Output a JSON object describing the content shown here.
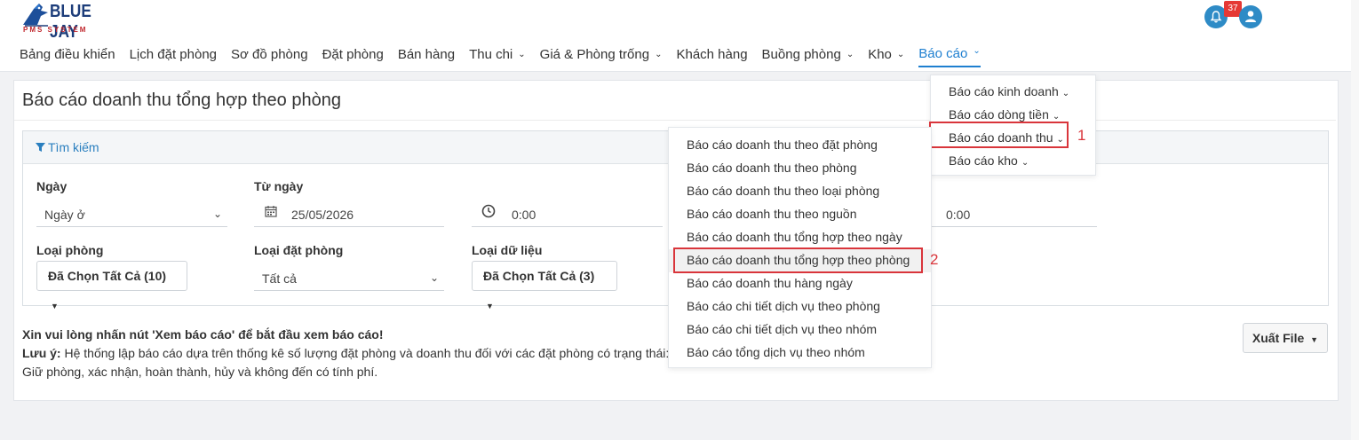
{
  "logo": {
    "title": "BLUE JAY",
    "subtitle": "PMS SYSTEM"
  },
  "header": {
    "notification_count": "37"
  },
  "nav": {
    "items": [
      {
        "label": "Bảng điều khiển"
      },
      {
        "label": "Lịch đặt phòng"
      },
      {
        "label": "Sơ đồ phòng"
      },
      {
        "label": "Đặt phòng"
      },
      {
        "label": "Bán hàng"
      },
      {
        "label": "Thu chi"
      },
      {
        "label": "Giá & Phòng trống"
      },
      {
        "label": "Khách hàng"
      },
      {
        "label": "Buồng phòng"
      },
      {
        "label": "Kho"
      },
      {
        "label": "Báo cáo"
      }
    ],
    "chevron": "˅"
  },
  "page": {
    "title": "Báo cáo doanh thu tổng hợp theo phòng"
  },
  "search": {
    "header_label": "Tìm kiếm",
    "date_type_label": "Ngày",
    "date_type_value": "Ngày ở",
    "from_label": "Từ ngày",
    "from_value": "25/05/2026",
    "from_time": "0:00",
    "to_time": "0:00",
    "room_type_label": "Loại phòng",
    "room_type_value": "Đã Chọn Tất Cả (10)",
    "booking_type_label": "Loại đặt phòng",
    "booking_type_value": "Tất cả",
    "data_type_label": "Loại dữ liệu",
    "data_type_value": "Đã Chọn Tất Cả (3)"
  },
  "note": {
    "instruction": "Xin vui lòng nhấn nút 'Xem báo cáo' để bắt đầu xem báo cáo!",
    "note_label": "Lưu ý:",
    "note_text": " Hệ thống lập báo cáo dựa trên thống kê số lượng đặt phòng và doanh thu đối với các đặt phòng có trạng thái:",
    "note_text2": "Giữ phòng, xác nhận, hoàn thành, hủy và không đến có tính phí."
  },
  "export": {
    "label": "Xuất File"
  },
  "report_menu": {
    "items": [
      {
        "label": "Báo cáo kinh doanh"
      },
      {
        "label": "Báo cáo dòng tiền"
      },
      {
        "label": "Báo cáo doanh thu"
      },
      {
        "label": "Báo cáo kho"
      }
    ]
  },
  "revenue_menu": {
    "items": [
      {
        "label": "Báo cáo doanh thu theo đặt phòng"
      },
      {
        "label": "Báo cáo doanh thu theo phòng"
      },
      {
        "label": "Báo cáo doanh thu theo loại phòng"
      },
      {
        "label": "Báo cáo doanh thu theo nguồn"
      },
      {
        "label": "Báo cáo doanh thu tổng hợp theo ngày"
      },
      {
        "label": "Báo cáo doanh thu tổng hợp theo phòng"
      },
      {
        "label": "Báo cáo doanh thu hàng ngày"
      },
      {
        "label": "Báo cáo chi tiết dịch vụ theo phòng"
      },
      {
        "label": "Báo cáo chi tiết dịch vụ theo nhóm"
      },
      {
        "label": "Báo cáo tổng dịch vụ theo nhóm"
      }
    ]
  },
  "annotations": {
    "step1": "1",
    "step2": "2"
  },
  "colors": {
    "accent": "#1e7fd0",
    "highlight": "#d9353b",
    "notification": "#e53935"
  }
}
